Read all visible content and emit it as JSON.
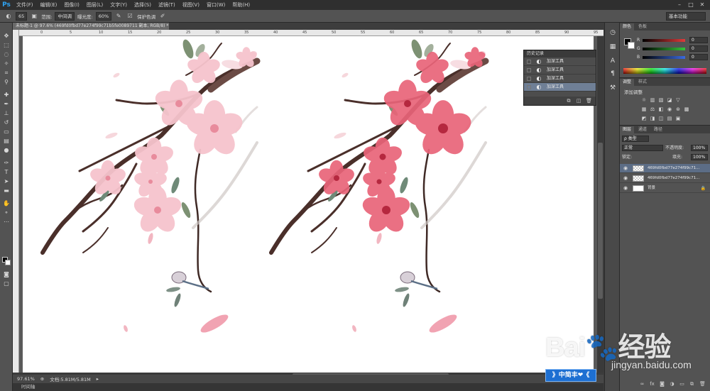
{
  "app": {
    "logo": "Ps"
  },
  "menus": [
    "文件(F)",
    "编辑(E)",
    "图像(I)",
    "图层(L)",
    "文字(Y)",
    "选择(S)",
    "滤镜(T)",
    "视图(V)",
    "窗口(W)",
    "帮助(H)"
  ],
  "window_controls": [
    "–",
    "□",
    "✕"
  ],
  "options": {
    "size": "65",
    "range_label": "范围:",
    "range_value": "中间调",
    "exposure_label": "曝光度:",
    "exposure_value": "60%",
    "protect_label": "保护色调",
    "workspace": "基本功能"
  },
  "document": {
    "tab_title": "未标题-1 @ 97.6% (469fd0fbd77e274f99c71b5fe0089711 副本, RGB/8) *",
    "zoom": "97.61%",
    "doc_info": "文档:5.81M/5.81M",
    "timeline": "时间轴"
  },
  "ruler": {
    "ticks": [
      "0",
      "5",
      "10",
      "15",
      "20",
      "25",
      "30",
      "35",
      "40",
      "45",
      "50",
      "55",
      "60",
      "65",
      "70",
      "75",
      "80",
      "85",
      "90",
      "95"
    ]
  },
  "history": {
    "title": "历史记录",
    "items": [
      {
        "label": "加深工具",
        "active": false
      },
      {
        "label": "加深工具",
        "active": false
      },
      {
        "label": "加深工具",
        "active": false
      },
      {
        "label": "加深工具",
        "active": true
      }
    ]
  },
  "panels": {
    "color_tabs": [
      "颜色",
      "色板"
    ],
    "rgb": [
      {
        "letter": "R",
        "value": "0",
        "color": "#e03a3a"
      },
      {
        "letter": "G",
        "value": "0",
        "color": "#35c43b"
      },
      {
        "letter": "B",
        "value": "0",
        "color": "#3a6ae0"
      }
    ],
    "adjust_tabs": [
      "调整",
      "样式"
    ],
    "adjust_title": "添加调整",
    "layers_tabs": [
      "图层",
      "通道",
      "路径"
    ],
    "filter_kind": "ρ 类型",
    "blend_mode": "正常",
    "opacity_label": "不透明度:",
    "opacity_value": "100%",
    "lock_label": "锁定:",
    "fill_label": "填充:",
    "fill_value": "100%",
    "layers": [
      {
        "name": "469fd0fbd77e274f99c71...",
        "active": true,
        "thumb": "checker",
        "locked": false
      },
      {
        "name": "469fd0fbd77e274f99c71...",
        "active": false,
        "thumb": "checker",
        "locked": false
      },
      {
        "name": "背景",
        "active": false,
        "thumb": "white",
        "locked": true
      }
    ]
  },
  "watermark": {
    "main": "Bai🐾经验",
    "sub": "jingyan.baidu.com",
    "badge": "》中简丰❤《"
  }
}
